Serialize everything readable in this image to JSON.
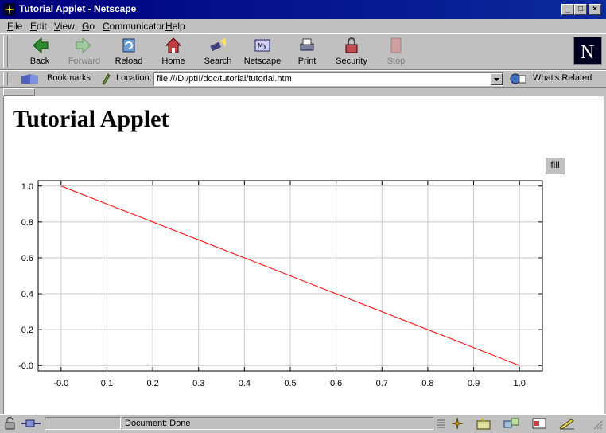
{
  "window": {
    "title": "Tutorial Applet - Netscape"
  },
  "menu": [
    {
      "label": "File",
      "key": "F",
      "rest": "ile"
    },
    {
      "label": "Edit",
      "key": "E",
      "rest": "dit"
    },
    {
      "label": "View",
      "key": "V",
      "rest": "iew"
    },
    {
      "label": "Go",
      "key": "G",
      "rest": "o"
    },
    {
      "label": "Communicator",
      "key": "C",
      "rest": "ommunicator"
    },
    {
      "label": "Help",
      "key": "H",
      "rest": "elp"
    }
  ],
  "toolbar": {
    "back": "Back",
    "forward": "Forward",
    "reload": "Reload",
    "home": "Home",
    "search": "Search",
    "netscape": "Netscape",
    "print": "Print",
    "security": "Security",
    "stop": "Stop"
  },
  "location": {
    "bookmarks": "Bookmarks",
    "label": "Location:",
    "url": "file:///D|/ptII/doc/tutorial/tutorial.htm",
    "whats_related": "What's Related"
  },
  "page": {
    "heading": "Tutorial Applet",
    "fill_button": "fill"
  },
  "chart_data": {
    "type": "line",
    "title": "",
    "xlabel": "",
    "ylabel": "",
    "xlim": [
      -0.05,
      1.05
    ],
    "ylim": [
      -0.03,
      1.03
    ],
    "xticks": [
      0.0,
      0.1,
      0.2,
      0.3,
      0.4,
      0.5,
      0.6,
      0.7,
      0.8,
      0.9,
      1.0
    ],
    "xtick_labels": [
      "-0.0",
      "0.1",
      "0.2",
      "0.3",
      "0.4",
      "0.5",
      "0.6",
      "0.7",
      "0.8",
      "0.9",
      "1.0"
    ],
    "yticks": [
      0.0,
      0.2,
      0.4,
      0.6,
      0.8,
      1.0
    ],
    "ytick_labels": [
      "-0.0",
      "0.2",
      "0.4",
      "0.6",
      "0.8",
      "1.0"
    ],
    "grid": true,
    "series": [
      {
        "color": "#ff0000",
        "x": [
          0.0,
          1.0
        ],
        "y": [
          1.0,
          0.0
        ]
      }
    ]
  },
  "status": {
    "text": "Document: Done"
  }
}
